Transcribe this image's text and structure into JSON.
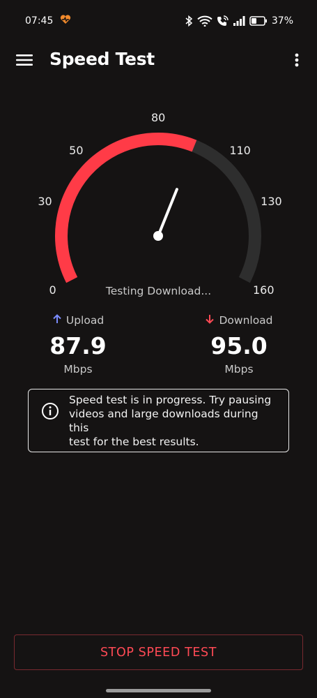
{
  "status_bar": {
    "time": "07:45",
    "battery_percent": "37%",
    "icons": [
      "heart-pulse-icon",
      "bluetooth-icon",
      "wifi-icon",
      "wifi-calling-icon",
      "signal-icon",
      "battery-icon"
    ]
  },
  "app_bar": {
    "title": "Speed Test",
    "menu_icon": "hamburger-menu-icon",
    "more_icon": "more-vertical-icon"
  },
  "gauge": {
    "tick_labels": [
      "0",
      "30",
      "50",
      "80",
      "110",
      "130",
      "160"
    ],
    "min": 0,
    "max": 160,
    "current_value": 95.0,
    "needle_value": 95.0,
    "active_color": "#ff3b47",
    "track_color": "#2e2e2e",
    "status_text": "Testing Download..."
  },
  "upload": {
    "label": "Upload",
    "value": "87.9",
    "unit": "Mbps",
    "icon": "arrow-up-icon",
    "icon_color": "#7b8cff"
  },
  "download": {
    "label": "Download",
    "value": "95.0",
    "unit": "Mbps",
    "icon": "arrow-down-icon",
    "icon_color": "#ff4a55"
  },
  "info_box": {
    "icon": "info-icon",
    "lines": [
      "Speed test is in progress. Try pausing",
      "videos and large downloads during this",
      "test for the best results."
    ]
  },
  "stop_button": {
    "label": "STOP SPEED TEST",
    "color": "#ff4a55"
  }
}
